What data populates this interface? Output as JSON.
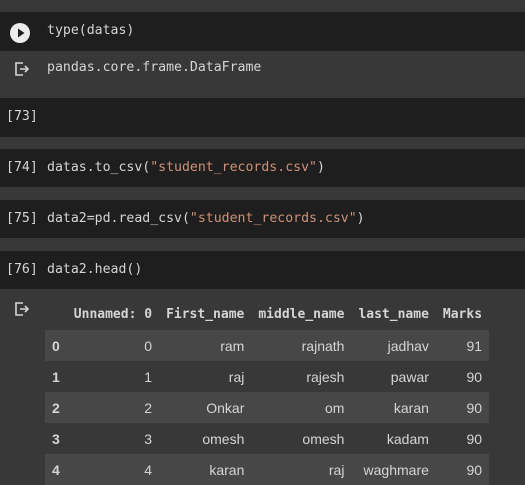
{
  "cells": [
    {
      "prompt": "",
      "code": "type(datas)",
      "has_run_button": true,
      "output": "pandas.core.frame.DataFrame"
    },
    {
      "prompt": "[73]",
      "code": ""
    },
    {
      "prompt": "[74]",
      "code_pre": "datas.to_csv(",
      "code_str": "\"student_records.csv\"",
      "code_post": ")"
    },
    {
      "prompt": "[75]",
      "code_pre": "data2=pd.read_csv(",
      "code_str": "\"student_records.csv\"",
      "code_post": ")"
    },
    {
      "prompt": "[76]",
      "code": "data2.head()"
    }
  ],
  "dataframe": {
    "columns": [
      "",
      "Unnamed: 0",
      "First_name",
      "middle_name",
      "last_name",
      "Marks"
    ],
    "rows": [
      [
        "0",
        "0",
        "ram",
        "rajnath",
        "jadhav",
        "91"
      ],
      [
        "1",
        "1",
        "raj",
        "rajesh",
        "pawar",
        "90"
      ],
      [
        "2",
        "2",
        "Onkar",
        "om",
        "karan",
        "90"
      ],
      [
        "3",
        "3",
        "omesh",
        "omesh",
        "kadam",
        "90"
      ],
      [
        "4",
        "4",
        "karan",
        "raj",
        "waghmare",
        "90"
      ]
    ]
  },
  "icons": {
    "run": "play-circle-icon",
    "output": "output-redirect-icon"
  },
  "colors": {
    "page_bg": "#383838",
    "cell_bg": "#1e1e1e",
    "string": "#ce9178",
    "text": "#d5d5d5"
  }
}
